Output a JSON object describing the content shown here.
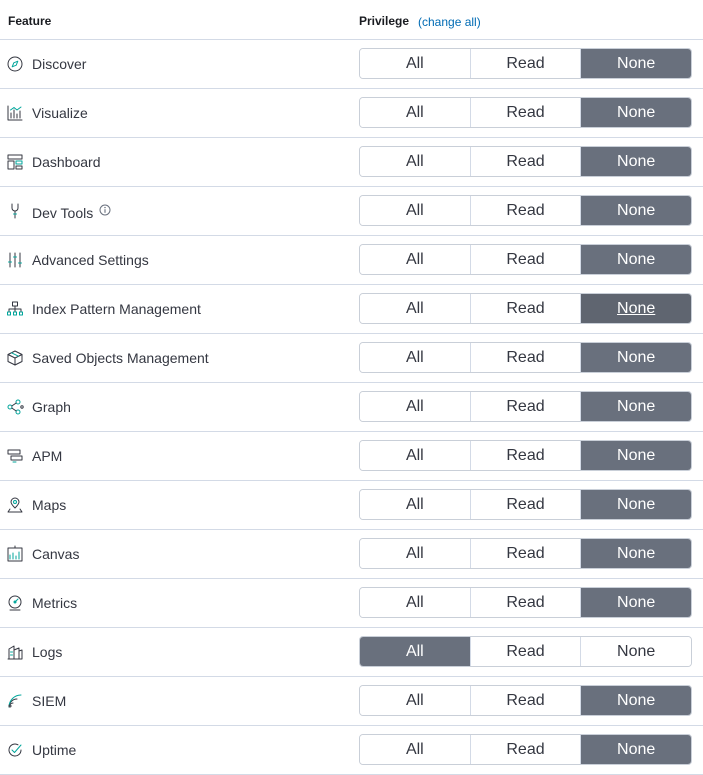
{
  "header": {
    "feature_label": "Feature",
    "privilege_label": "Privilege",
    "change_all_label": "(change all)"
  },
  "options": [
    "All",
    "Read",
    "None"
  ],
  "colors": {
    "selected": "#69707d",
    "accent": "#00a69b",
    "link": "#006bb4"
  },
  "features": [
    {
      "name": "Discover",
      "icon": "compass-icon",
      "selected": "None"
    },
    {
      "name": "Visualize",
      "icon": "visualize-icon",
      "selected": "None"
    },
    {
      "name": "Dashboard",
      "icon": "dashboard-icon",
      "selected": "None"
    },
    {
      "name": "Dev Tools",
      "icon": "wrench-icon",
      "selected": "None",
      "info": true
    },
    {
      "name": "Advanced Settings",
      "icon": "sliders-icon",
      "selected": "None"
    },
    {
      "name": "Index Pattern Management",
      "icon": "index-pattern-icon",
      "selected": "None",
      "focused": true
    },
    {
      "name": "Saved Objects Management",
      "icon": "package-icon",
      "selected": "None"
    },
    {
      "name": "Graph",
      "icon": "graph-icon",
      "selected": "None"
    },
    {
      "name": "APM",
      "icon": "apm-icon",
      "selected": "None"
    },
    {
      "name": "Maps",
      "icon": "map-pin-icon",
      "selected": "None"
    },
    {
      "name": "Canvas",
      "icon": "canvas-icon",
      "selected": "None"
    },
    {
      "name": "Metrics",
      "icon": "metrics-icon",
      "selected": "None"
    },
    {
      "name": "Logs",
      "icon": "logs-icon",
      "selected": "All"
    },
    {
      "name": "SIEM",
      "icon": "siem-icon",
      "selected": "None"
    },
    {
      "name": "Uptime",
      "icon": "uptime-icon",
      "selected": "None"
    }
  ]
}
